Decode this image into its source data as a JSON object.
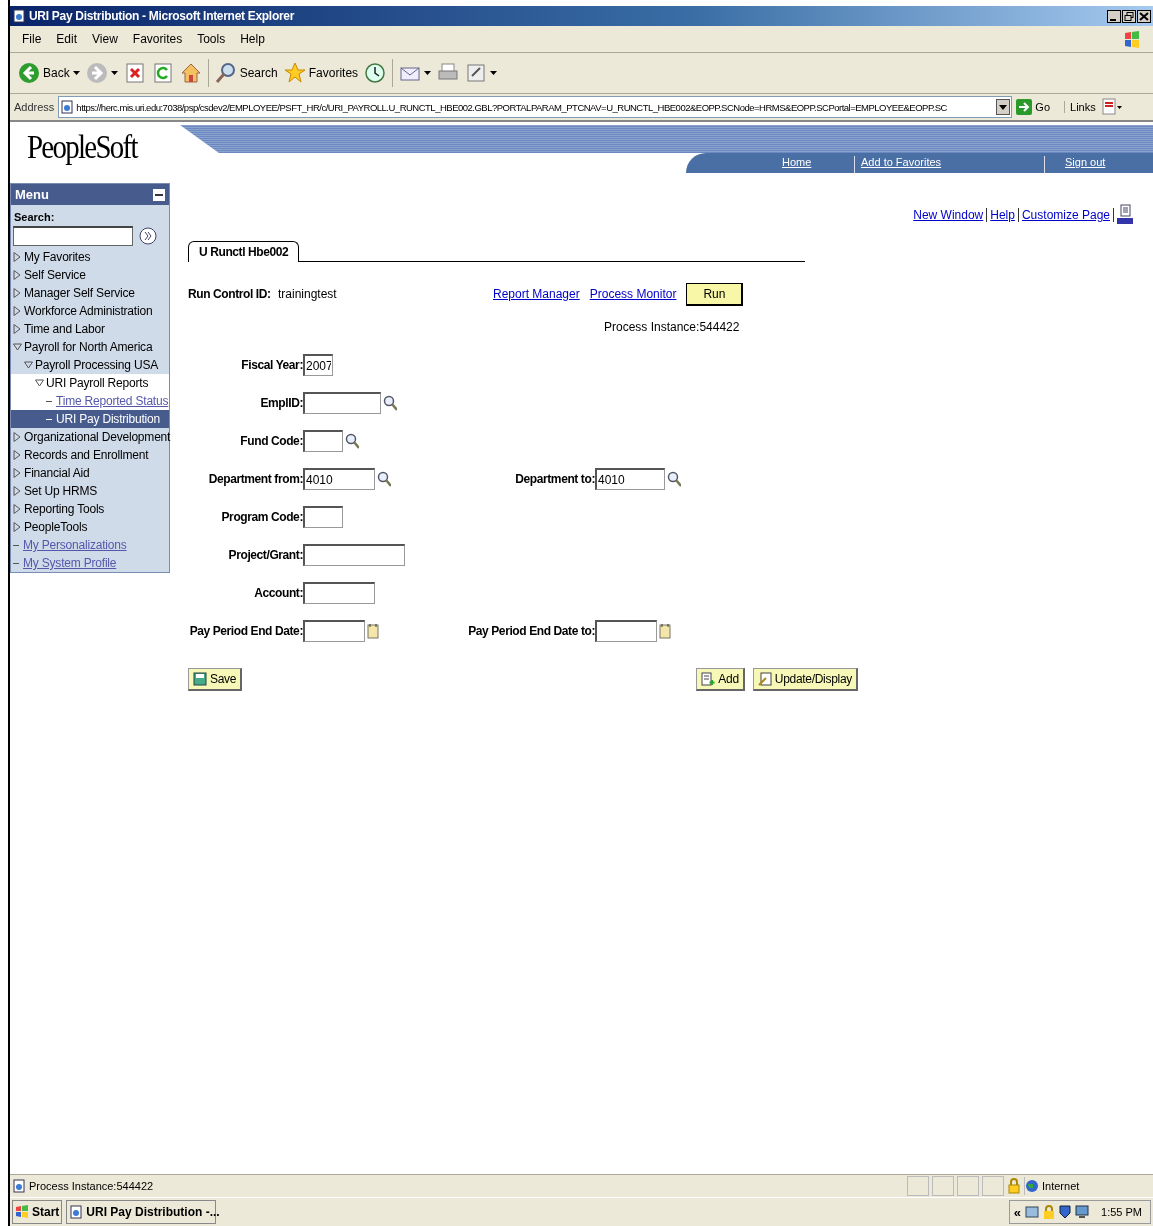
{
  "window": {
    "title": "URI Pay Distribution - Microsoft Internet Explorer"
  },
  "menu_bar": [
    "File",
    "Edit",
    "View",
    "Favorites",
    "Tools",
    "Help"
  ],
  "toolbar": [
    {
      "kind": "back",
      "label": "Back",
      "dropdown": true
    },
    {
      "kind": "forward",
      "dropdown": true
    },
    {
      "kind": "stop",
      "dropdown": false
    },
    {
      "kind": "refresh",
      "dropdown": false
    },
    {
      "kind": "home",
      "dropdown": false
    },
    {
      "kind": "search",
      "label": "Search",
      "dropdown": false
    },
    {
      "kind": "favorites",
      "label": "Favorites",
      "dropdown": false
    },
    {
      "kind": "history",
      "dropdown": false
    },
    {
      "kind": "mail",
      "dropdown": true
    },
    {
      "kind": "print",
      "dropdown": false
    },
    {
      "kind": "edit",
      "dropdown": true
    }
  ],
  "address_bar": {
    "label": "Address",
    "url": "https://herc.mis.uri.edu:7038/psp/csdev2/EMPLOYEE/PSFT_HR/c/URI_PAYROLL.U_RUNCTL_HBE002.GBL?PORTALPARAM_PTCNAV=U_RUNCTL_HBE002&EOPP.SCNode=HRMS&EOPP.SCPortal=EMPLOYEE&EOPP.SC",
    "go": "Go",
    "links": "Links"
  },
  "header": {
    "logo": "PeopleSoft",
    "nav": [
      "Home",
      "Add to Favorites",
      "Sign out"
    ]
  },
  "sidebar": {
    "title": "Menu",
    "search_label": "Search:",
    "items": [
      {
        "label": "My Favorites",
        "kind": "folder",
        "expanded": false,
        "selected": false
      },
      {
        "label": "Self Service",
        "kind": "folder",
        "expanded": false,
        "selected": false
      },
      {
        "label": "Manager Self Service",
        "kind": "folder",
        "expanded": false,
        "selected": false
      },
      {
        "label": "Workforce Administration",
        "kind": "folder",
        "expanded": false,
        "selected": false
      },
      {
        "label": "Time and Labor",
        "kind": "folder",
        "expanded": false,
        "selected": false
      },
      {
        "label": "Payroll for North America",
        "kind": "folder",
        "expanded": true,
        "selected": false,
        "children": [
          {
            "label": "Payroll Processing USA",
            "kind": "folder",
            "expanded": true,
            "selected": false,
            "children": [
              {
                "label": "URI Payroll Reports",
                "kind": "folder",
                "expanded": true,
                "selected": false,
                "children": [
                  {
                    "label": "Time Reported Status",
                    "kind": "link",
                    "selected": false
                  },
                  {
                    "label": "URI Pay Distribution",
                    "kind": "link",
                    "selected": true
                  }
                ]
              }
            ]
          }
        ]
      },
      {
        "label": "Organizational Development",
        "kind": "folder",
        "expanded": false,
        "selected": false
      },
      {
        "label": "Records and Enrollment",
        "kind": "folder",
        "expanded": false,
        "selected": false
      },
      {
        "label": "Financial Aid",
        "kind": "folder",
        "expanded": false,
        "selected": false
      },
      {
        "label": "Set Up HRMS",
        "kind": "folder",
        "expanded": false,
        "selected": false
      },
      {
        "label": "Reporting Tools",
        "kind": "folder",
        "expanded": false,
        "selected": false
      },
      {
        "label": "PeopleTools",
        "kind": "folder",
        "expanded": false,
        "selected": false
      },
      {
        "label": "My Personalizations",
        "kind": "link",
        "selected": false
      },
      {
        "label": "My System Profile",
        "kind": "link",
        "selected": false
      }
    ]
  },
  "page_links": [
    "New Window",
    "Help",
    "Customize Page"
  ],
  "tabs": [
    {
      "label": "U Runctl Hbe002",
      "selected": true
    }
  ],
  "run_control": {
    "label": "Run Control ID:",
    "value": "trainingtest",
    "links": [
      "Report Manager",
      "Process Monitor"
    ],
    "run_button": "Run",
    "process_instance": "Process Instance:544422"
  },
  "form_rows": [
    [
      {
        "label": "Fiscal Year:",
        "value": "2007",
        "kind": "plain"
      }
    ],
    [
      {
        "label": "EmplID:",
        "kind": "lookup"
      }
    ],
    [
      {
        "label": "Fund Code:",
        "kind": "lookup"
      }
    ],
    [
      {
        "label": "Department from:",
        "value": "4010",
        "kind": "lookup"
      },
      {
        "label": "Department to:",
        "value": "4010",
        "kind": "lookup"
      }
    ],
    [
      {
        "label": "Program Code:",
        "kind": "plain"
      }
    ],
    [
      {
        "label": "Project/Grant:",
        "kind": "plain"
      }
    ],
    [
      {
        "label": "Account:",
        "kind": "plain"
      }
    ],
    [
      {
        "label": "Pay Period End Date:",
        "kind": "date"
      },
      {
        "label": "Pay Period End Date to:",
        "kind": "date"
      }
    ]
  ],
  "buttons": [
    {
      "label": "Save",
      "kind": "save"
    },
    {
      "label": "Add",
      "kind": "add"
    },
    {
      "label": "Update/Display",
      "kind": "update"
    }
  ],
  "status_bar": {
    "text": "Process Instance:544422",
    "zone": "Internet"
  },
  "taskbar": {
    "start": "Start",
    "task": "URI Pay Distribution -...",
    "tray_toggle": "«",
    "clock": "1:55 PM"
  }
}
